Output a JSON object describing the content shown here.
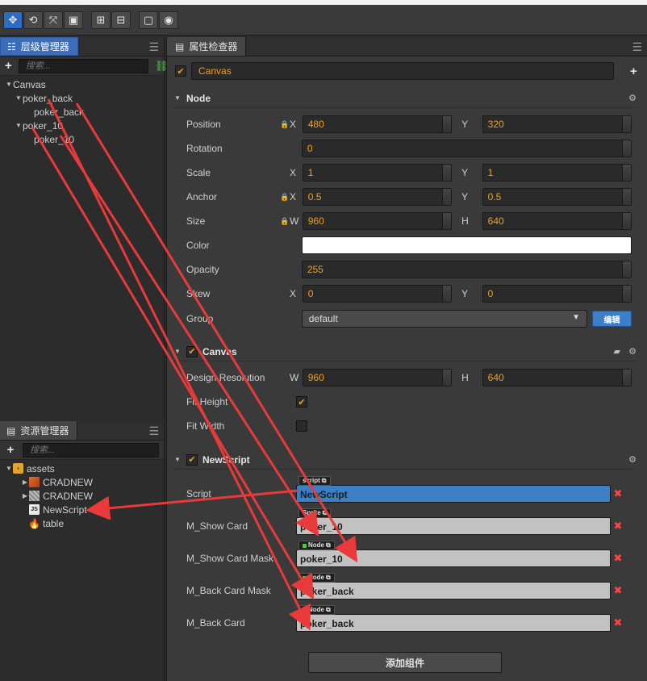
{
  "toolbar": {
    "buttons": [
      {
        "icon": "move-icon",
        "glyph": "✥"
      },
      {
        "icon": "rotate-icon",
        "glyph": "⟲"
      },
      {
        "icon": "scale-icon",
        "glyph": "⤧"
      },
      {
        "icon": "rect-icon",
        "glyph": "▣"
      },
      {
        "icon": "anchor-icon",
        "glyph": "⊞"
      },
      {
        "icon": "grid-icon",
        "glyph": "⊟"
      },
      {
        "icon": "preview-icon",
        "glyph": "▢"
      },
      {
        "icon": "record-icon",
        "glyph": "◉"
      }
    ]
  },
  "hierarchy": {
    "title": "层级管理器",
    "search_placeholder": "搜索...",
    "nodes": [
      {
        "label": "Canvas",
        "level": 0,
        "expanded": true
      },
      {
        "label": "poker_back",
        "level": 1,
        "expanded": true
      },
      {
        "label": "poker_back",
        "level": 2,
        "expanded": false
      },
      {
        "label": "poker_10",
        "level": 1,
        "expanded": true
      },
      {
        "label": "poker_10",
        "level": 2,
        "expanded": false
      }
    ]
  },
  "assets": {
    "title": "资源管理器",
    "search_placeholder": "搜索...",
    "items": [
      {
        "label": "assets",
        "icon": "folder-icon",
        "level": 0
      },
      {
        "label": "CRADNEW",
        "icon": "image-icon",
        "level": 1
      },
      {
        "label": "CRADNEW",
        "icon": "atlas-icon",
        "level": 1
      },
      {
        "label": "NewScript",
        "icon": "js-icon",
        "level": 1
      },
      {
        "label": "table",
        "icon": "fire-icon",
        "level": 1
      }
    ]
  },
  "inspector": {
    "title": "属性检查器",
    "node_name": "Canvas",
    "node_section": "Node",
    "position": {
      "label": "Position",
      "x_axis": "X",
      "y_axis": "Y",
      "x": "480",
      "y": "320"
    },
    "rotation": {
      "label": "Rotation",
      "value": "0"
    },
    "scale": {
      "label": "Scale",
      "x_axis": "X",
      "y_axis": "Y",
      "x": "1",
      "y": "1"
    },
    "anchor": {
      "label": "Anchor",
      "x_axis": "X",
      "y_axis": "Y",
      "x": "0.5",
      "y": "0.5"
    },
    "size": {
      "label": "Size",
      "w_axis": "W",
      "h_axis": "H",
      "w": "960",
      "h": "640"
    },
    "color": {
      "label": "Color",
      "value": "#ffffff"
    },
    "opacity": {
      "label": "Opacity",
      "value": "255"
    },
    "skew": {
      "label": "Skew",
      "x_axis": "X",
      "y_axis": "Y",
      "x": "0",
      "y": "0"
    },
    "group": {
      "label": "Group",
      "value": "default",
      "edit_label": "编辑"
    },
    "canvas_section": "Canvas",
    "design_resolution": {
      "label": "Design Resolution",
      "w_axis": "W",
      "h_axis": "H",
      "w": "960",
      "h": "640"
    },
    "fit_height": {
      "label": "Fit Height",
      "checked": true
    },
    "fit_width": {
      "label": "Fit Width",
      "checked": false
    },
    "script_section": "NewScript",
    "script": {
      "label": "Script",
      "value": "NewScript",
      "tag": "script"
    },
    "show_card": {
      "label": "M_Show Card",
      "value": "poker_10",
      "tag": "Sprite"
    },
    "show_card_mask": {
      "label": "M_Show Card Mask",
      "value": "poker_10",
      "tag": "Node"
    },
    "back_card_mask": {
      "label": "M_Back Card Mask",
      "value": "poker_back",
      "tag": "Node"
    },
    "back_card": {
      "label": "M_Back Card",
      "value": "poker_back",
      "tag": "Node"
    },
    "add_component": "添加组件"
  },
  "colors": {
    "accent_orange": "#f0a020",
    "selected_blue": "#3c6db8",
    "annotation_red": "#e83a3a"
  }
}
